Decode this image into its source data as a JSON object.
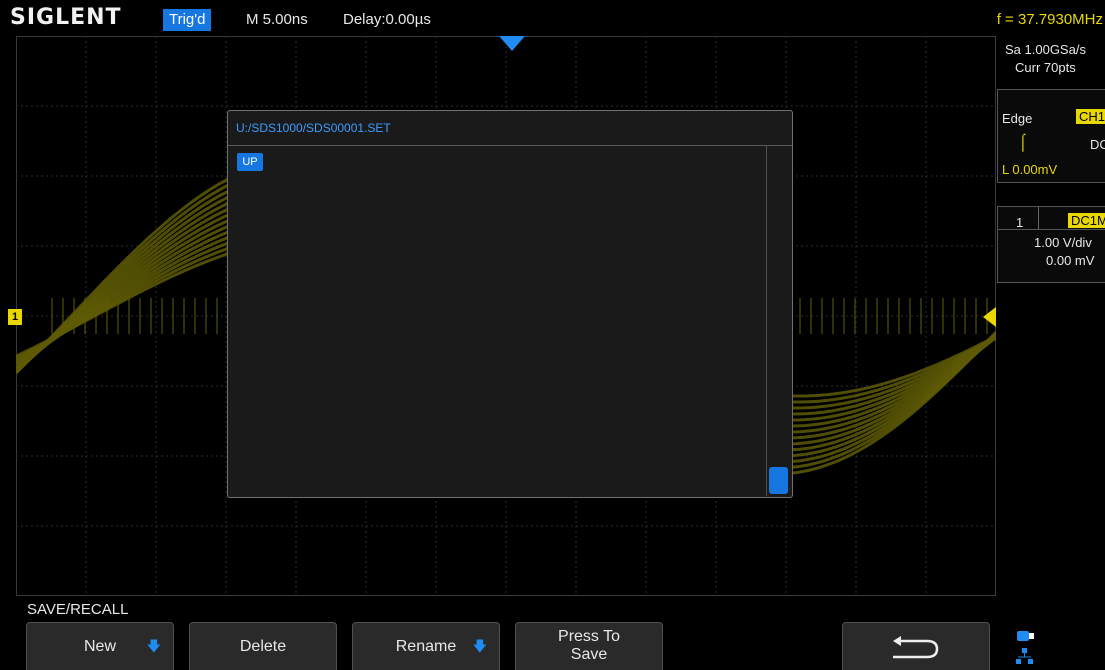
{
  "topbar": {
    "brand": "SIGLENT",
    "trigger_status": "Trig'd",
    "timebase": "M 5.00ns",
    "delay": "Delay:0.00µs",
    "frequency": "f = 37.7930MHz"
  },
  "acquisition": {
    "sample_rate": "Sa 1.00GSa/s",
    "curr_points": "Curr 70pts"
  },
  "trigger": {
    "type": "Edge",
    "source": "CH1",
    "coupling": "DC",
    "level": "L  0.00mV"
  },
  "channel": {
    "number": "1",
    "coupling_impedance": "DC1M",
    "volts_per_div": "1.00 V/div",
    "offset": "0.00 mV"
  },
  "markers": {
    "ch1_label": "1"
  },
  "dialog": {
    "path": "U:/SDS1000/SDS00001.SET",
    "up_label": "UP"
  },
  "menu": {
    "title": "SAVE/RECALL",
    "new_label": "New",
    "delete_label": "Delete",
    "rename_label": "Rename",
    "press_to_save_line1": "Press To",
    "press_to_save_line2": "Save"
  },
  "colors": {
    "accent_blue": "#1677e0",
    "channel_yellow": "#e8d800",
    "waveform": "#5e5a06"
  },
  "icons": {
    "back": "return-arrow-icon",
    "usb": "usb-icon",
    "network": "network-icon"
  }
}
